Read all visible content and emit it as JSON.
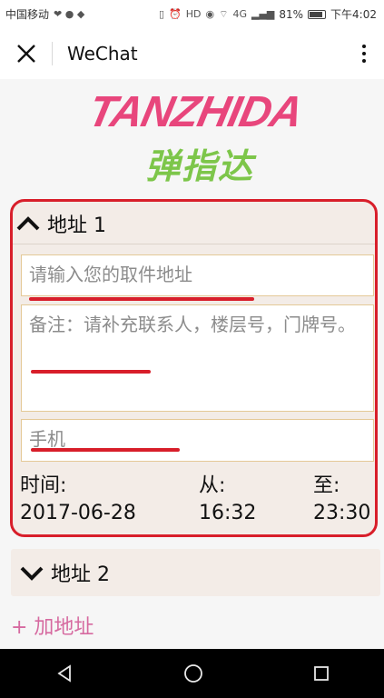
{
  "status_bar": {
    "carrier": "中国移动",
    "network": "4G",
    "battery_percent": "81%",
    "time": "下午4:02"
  },
  "title_bar": {
    "title": "WeChat"
  },
  "logo": {
    "brand_en": "TANZHIDA",
    "brand_cn": "弹指达"
  },
  "address1": {
    "title": "地址 1",
    "pickup_placeholder": "请输入您的取件地址",
    "notes_placeholder": "备注：请补充联系人，楼层号，门牌号。",
    "phone_placeholder": "手机",
    "time_label": "时间:",
    "from_label": "从:",
    "to_label": "至:",
    "date": "2017-06-28",
    "from_time": "16:32",
    "to_time": "23:30"
  },
  "address2": {
    "title": "地址 2"
  },
  "add_address_label": "+ 加地址",
  "colors": {
    "highlight_red": "#d81e2a",
    "brand_pink": "#e8467c",
    "brand_green": "#7dc64a",
    "link_pink": "#d66aa0",
    "card_bg": "#f3ece7"
  }
}
